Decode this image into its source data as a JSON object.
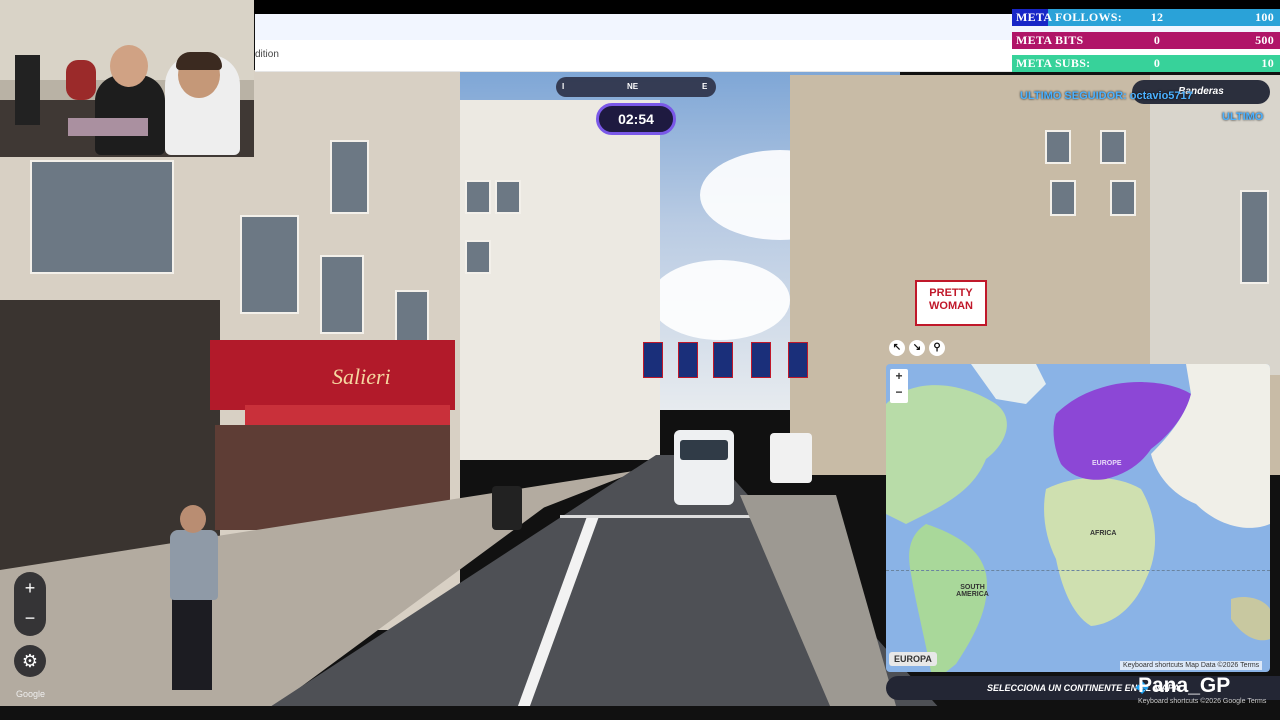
{
  "browser": {
    "address_partial": "dition"
  },
  "compass": {
    "left_tick": "I",
    "heading": "NE",
    "right_label": "E"
  },
  "timer": {
    "value": "02:54"
  },
  "meta": {
    "follows": {
      "label": "META FOLLOWS:",
      "current": "12",
      "max": "100"
    },
    "bits": {
      "label": "META BITS",
      "current": "0",
      "max": "500"
    },
    "subs": {
      "label": "META SUBS:",
      "current": "0",
      "max": "10"
    }
  },
  "banderas_label": "Banderas",
  "ultimo_seguidor": "ULTIMO SEGUIDOR: octavio5717",
  "ultimo_partial": "ULTIMO",
  "map": {
    "zoom_in": "+",
    "zoom_out": "−",
    "labels": {
      "africa": "AFRICA",
      "south_america": "SOUTH AMERICA",
      "europe": "EUROPE"
    },
    "selected_region": "EUROPA",
    "footer": "Keyboard shortcuts   Map Data ©2026   Terms"
  },
  "tool_icons": [
    "expand-icon",
    "shrink-icon",
    "pin-icon"
  ],
  "select_prompt": "SELECCIONA UN CONTINENTE EN EL MAPA",
  "streamer_name": "Pana_GP",
  "bottom_footer": "Keyboard shortcuts  ©2026 Google  Terms",
  "streetview": {
    "zoom_in": "+",
    "zoom_out": "−",
    "attribution": "Google",
    "shop_sign": "Salieri",
    "poster": "PRETTY WOMAN"
  },
  "colors": {
    "timer_border": "#7a58e8",
    "europe_highlight": "#8c47d6",
    "meta_bits": "#b01568",
    "meta_subs": "#37d29a",
    "meta_follows": "#2aa2d8"
  }
}
